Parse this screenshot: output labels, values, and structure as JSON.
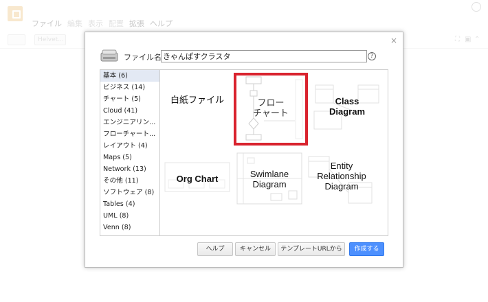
{
  "app": {
    "menu": [
      "ファイル",
      "編集",
      "表示",
      "配置",
      "拡張",
      "ヘルプ"
    ],
    "toolbar_font": "Helvet..."
  },
  "dialog": {
    "filename_label": "ファイル名:",
    "filename_value": "きゃんぱすクラスタ",
    "close_label": "×",
    "help_glyph": "?"
  },
  "categories": [
    {
      "label": "基本 (6)",
      "selected": true
    },
    {
      "label": "ビジネス (14)"
    },
    {
      "label": "チャート (5)"
    },
    {
      "label": "Cloud (41)"
    },
    {
      "label": "エンジニアリン..."
    },
    {
      "label": "フローチャート..."
    },
    {
      "label": "レイアウト (4)"
    },
    {
      "label": "Maps (5)"
    },
    {
      "label": "Network (13)"
    },
    {
      "label": "その他 (11)"
    },
    {
      "label": "ソフトウェア (8)"
    },
    {
      "label": "Tables (4)"
    },
    {
      "label": "UML (8)"
    },
    {
      "label": "Venn (8)"
    }
  ],
  "templates": {
    "blank": "白紙ファイル",
    "flowchart": "フロー\nチャート",
    "class": "Class\nDiagram",
    "org": "Org Chart",
    "swimlane": "Swimlane\nDiagram",
    "er": "Entity\nRelationship\nDiagram"
  },
  "buttons": {
    "help": "ヘルプ",
    "cancel": "キャンセル",
    "template_url": "テンプレートURLから",
    "create": "作成する"
  },
  "colors": {
    "accent": "#4d90fe",
    "selection_border": "#d9232e"
  }
}
